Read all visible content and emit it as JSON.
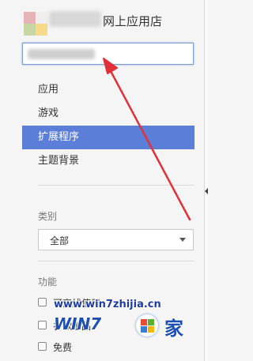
{
  "header": {
    "title": "网上应用店",
    "logo_icon": "chrome-web-store-icon"
  },
  "search": {
    "value": ""
  },
  "nav": {
    "items": [
      {
        "label": "应用",
        "selected": false
      },
      {
        "label": "游戏",
        "selected": false
      },
      {
        "label": "扩展程序",
        "selected": true
      },
      {
        "label": "主题背景",
        "selected": false
      }
    ]
  },
  "category": {
    "label": "类别",
    "selected": "全部"
  },
  "features": {
    "label": "功能",
    "items": [
      {
        "label": "可离线使用",
        "checked": false
      },
      {
        "label": "谷歌出品",
        "checked": false
      },
      {
        "label": "免费",
        "checked": false
      }
    ]
  },
  "watermark": {
    "url": "www.win7zhijia.cn",
    "brand": "WIN7",
    "suffix": "家"
  },
  "colors": {
    "accent": "#5b7ed8",
    "annotation_arrow": "#e0313a",
    "panel_bg": "#f5f5f5"
  }
}
